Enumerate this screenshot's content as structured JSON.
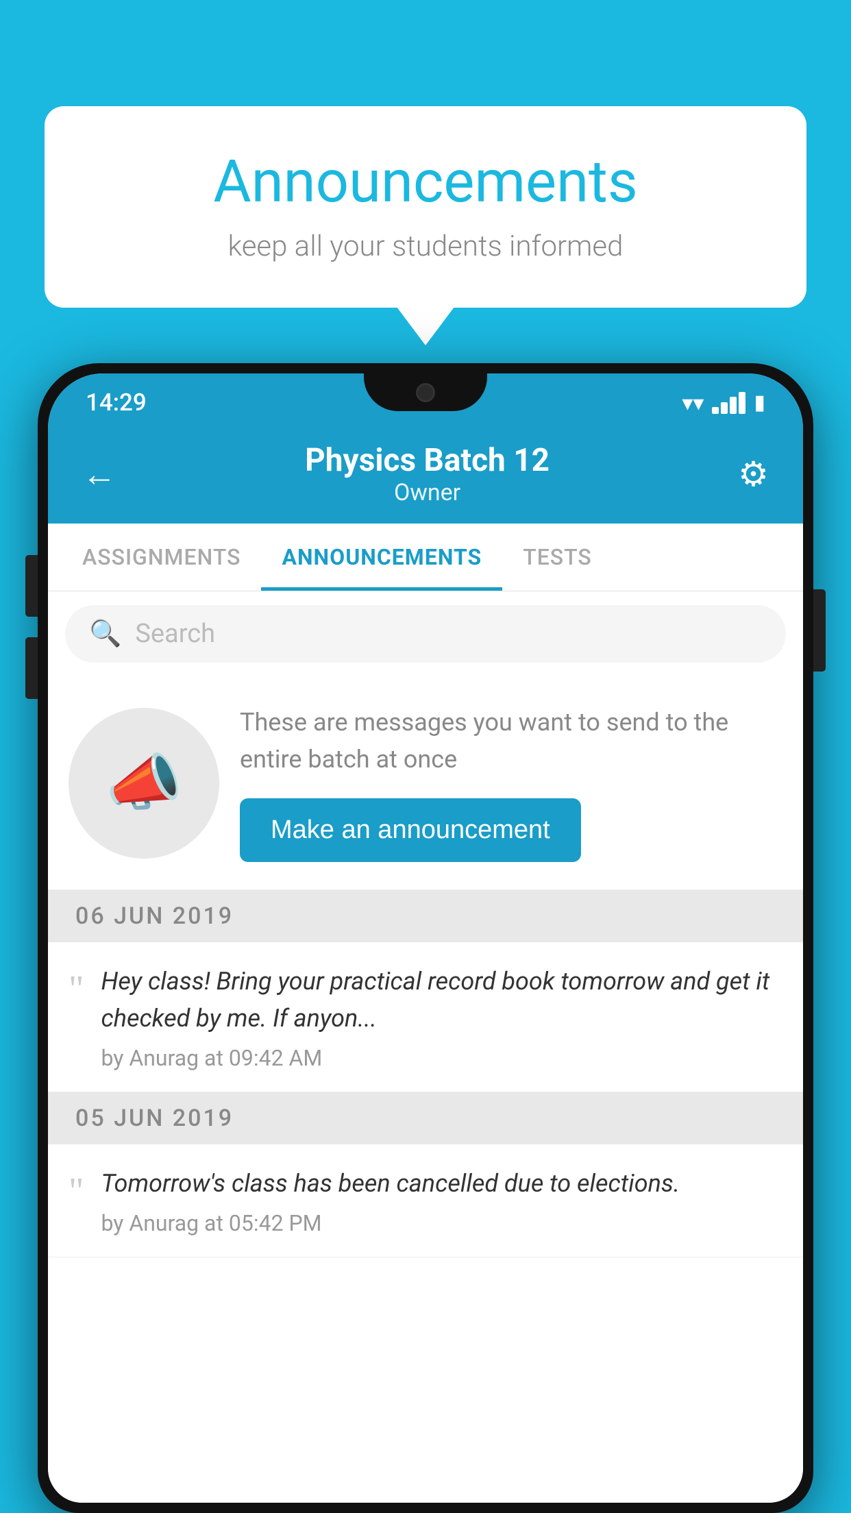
{
  "page": {
    "background_color": "#1BB8E0"
  },
  "speech_bubble": {
    "title": "Announcements",
    "subtitle": "keep all your students informed"
  },
  "status_bar": {
    "time": "14:29"
  },
  "header": {
    "title": "Physics Batch 12",
    "subtitle": "Owner",
    "back_label": "←",
    "settings_label": "⚙"
  },
  "tabs": [
    {
      "id": "assignments",
      "label": "ASSIGNMENTS",
      "active": false
    },
    {
      "id": "announcements",
      "label": "ANNOUNCEMENTS",
      "active": true
    },
    {
      "id": "tests",
      "label": "TESTS",
      "active": false
    }
  ],
  "search": {
    "placeholder": "Search"
  },
  "promo": {
    "description": "These are messages you want to send to the entire batch at once",
    "button_label": "Make an announcement"
  },
  "announcements": [
    {
      "date": "06  JUN  2019",
      "text": "Hey class! Bring your practical record book tomorrow and get it checked by me. If anyon...",
      "author": "by Anurag at 09:42 AM"
    },
    {
      "date": "05  JUN  2019",
      "text": "Tomorrow's class has been cancelled due to elections.",
      "author": "by Anurag at 05:42 PM"
    }
  ]
}
